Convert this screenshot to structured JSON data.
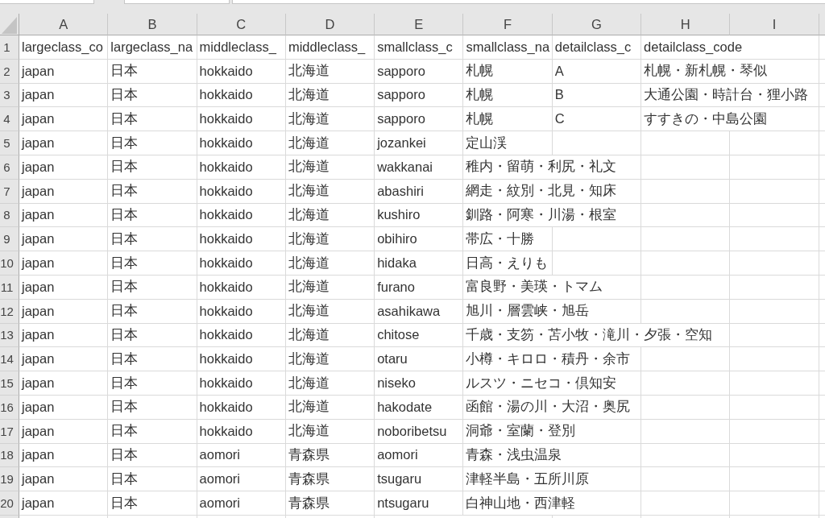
{
  "toolbar": {
    "fields": [
      {
        "kind": "name_box"
      },
      {
        "kind": "function_box"
      },
      {
        "kind": "formula_bar"
      }
    ]
  },
  "sheet": {
    "columns": [
      "A",
      "B",
      "C",
      "D",
      "E",
      "F",
      "G",
      "H",
      "I"
    ],
    "rows": [
      {
        "header": "1",
        "cells": [
          "largeclass_co",
          "largeclass_na",
          "middleclass_",
          "middleclass_",
          "smallclass_c",
          "smallclass_na",
          "detailclass_c",
          "detailclass_code"
        ]
      },
      {
        "header": "2",
        "cells": [
          "japan",
          "日本",
          "hokkaido",
          "北海道",
          "sapporo",
          "札幌",
          "A",
          "札幌・新札幌・琴似"
        ]
      },
      {
        "header": "3",
        "cells": [
          "japan",
          "日本",
          "hokkaido",
          "北海道",
          "sapporo",
          "札幌",
          "B",
          "大通公園・時計台・狸小路"
        ]
      },
      {
        "header": "4",
        "cells": [
          "japan",
          "日本",
          "hokkaido",
          "北海道",
          "sapporo",
          "札幌",
          "C",
          "すすきの・中島公園"
        ]
      },
      {
        "header": "5",
        "cells": [
          "japan",
          "日本",
          "hokkaido",
          "北海道",
          "jozankei",
          "定山渓"
        ]
      },
      {
        "header": "6",
        "cells": [
          "japan",
          "日本",
          "hokkaido",
          "北海道",
          "wakkanai",
          "稚内・留萌・利尻・礼文"
        ]
      },
      {
        "header": "7",
        "cells": [
          "japan",
          "日本",
          "hokkaido",
          "北海道",
          "abashiri",
          "網走・紋別・北見・知床"
        ]
      },
      {
        "header": "8",
        "cells": [
          "japan",
          "日本",
          "hokkaido",
          "北海道",
          "kushiro",
          "釧路・阿寒・川湯・根室"
        ]
      },
      {
        "header": "9",
        "cells": [
          "japan",
          "日本",
          "hokkaido",
          "北海道",
          "obihiro",
          "帯広・十勝"
        ]
      },
      {
        "header": "10",
        "cells": [
          "japan",
          "日本",
          "hokkaido",
          "北海道",
          "hidaka",
          "日高・えりも"
        ]
      },
      {
        "header": "11",
        "cells": [
          "japan",
          "日本",
          "hokkaido",
          "北海道",
          "furano",
          "富良野・美瑛・トマム"
        ]
      },
      {
        "header": "12",
        "cells": [
          "japan",
          "日本",
          "hokkaido",
          "北海道",
          "asahikawa",
          "旭川・層雲峡・旭岳"
        ]
      },
      {
        "header": "13",
        "cells": [
          "japan",
          "日本",
          "hokkaido",
          "北海道",
          "chitose",
          "千歳・支笏・苫小牧・滝川・夕張・空知"
        ]
      },
      {
        "header": "14",
        "cells": [
          "japan",
          "日本",
          "hokkaido",
          "北海道",
          "otaru",
          "小樽・キロロ・積丹・余市"
        ]
      },
      {
        "header": "15",
        "cells": [
          "japan",
          "日本",
          "hokkaido",
          "北海道",
          "niseko",
          "ルスツ・ニセコ・倶知安"
        ]
      },
      {
        "header": "16",
        "cells": [
          "japan",
          "日本",
          "hokkaido",
          "北海道",
          "hakodate",
          "函館・湯の川・大沼・奥尻"
        ]
      },
      {
        "header": "17",
        "cells": [
          "japan",
          "日本",
          "hokkaido",
          "北海道",
          "noboribetsu",
          "洞爺・室蘭・登別"
        ]
      },
      {
        "header": "18",
        "cells": [
          "japan",
          "日本",
          "aomori",
          "青森県",
          "aomori",
          "青森・浅虫温泉"
        ]
      },
      {
        "header": "19",
        "cells": [
          "japan",
          "日本",
          "aomori",
          "青森県",
          "tsugaru",
          "津軽半島・五所川原"
        ]
      },
      {
        "header": "20",
        "cells": [
          "japan",
          "日本",
          "aomori",
          "青森県",
          "ntsugaru",
          "白神山地・西津軽"
        ]
      }
    ]
  }
}
